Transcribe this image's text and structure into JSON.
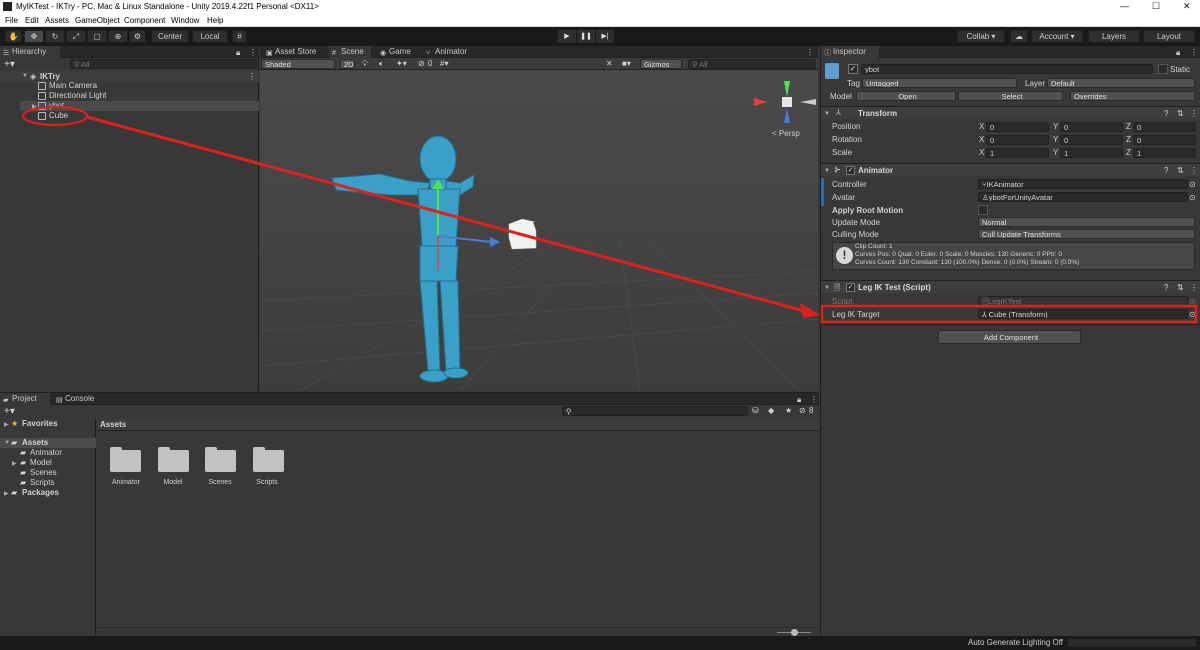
{
  "window": {
    "title": "MyIKTest - IKTry - PC, Mac & Linux Standalone - Unity 2019.4.22f1 Personal <DX11>",
    "min": "—",
    "max": "☐",
    "close": "✕"
  },
  "menu": [
    "File",
    "Edit",
    "Assets",
    "GameObject",
    "Component",
    "Window",
    "Help"
  ],
  "toolbar": {
    "pivot": "Center",
    "space": "Local",
    "collab": "Collab ▾",
    "account": "Account ▾",
    "layers": "Layers",
    "layout": "Layout"
  },
  "hierarchy": {
    "tab": "Hierarchy",
    "search_placeholder": "All",
    "scene": "IKTry",
    "items": [
      "Main Camera",
      "Directional Light",
      "ybot",
      "Cube"
    ]
  },
  "scene_tabs": [
    "Asset Store",
    "Scene",
    "Game",
    "Animator"
  ],
  "scene_toolbar": {
    "shading": "Shaded",
    "mode2d": "2D",
    "hidden_count": "0",
    "gizmos": "Gizmos",
    "search_placeholder": "All"
  },
  "scene_view": {
    "persp": "< Persp"
  },
  "inspector": {
    "tab": "Inspector",
    "object_name": "ybot",
    "static": "Static",
    "tag_label": "Tag",
    "tag_value": "Untagged",
    "layer_label": "Layer",
    "layer_value": "Default",
    "model_label": "Model",
    "open": "Open",
    "select": "Select",
    "overrides": "Overrides",
    "transform": {
      "title": "Transform",
      "rows": [
        {
          "label": "Position",
          "x": "0",
          "y": "0",
          "z": "0"
        },
        {
          "label": "Rotation",
          "x": "0",
          "y": "0",
          "z": "0"
        },
        {
          "label": "Scale",
          "x": "1",
          "y": "1",
          "z": "1"
        }
      ]
    },
    "animator": {
      "title": "Animator",
      "controller_label": "Controller",
      "controller_value": "IKAnimator",
      "avatar_label": "Avatar",
      "avatar_value": "ybotForUnityAvatar",
      "root_motion_label": "Apply Root Motion",
      "update_mode_label": "Update Mode",
      "update_mode_value": "Normal",
      "culling_label": "Culling Mode",
      "culling_value": "Cull Update Transforms",
      "info_line1": "Clip Count: 1",
      "info_line2": "Curves Pos: 0 Quat: 0 Euler: 0 Scale: 0 Muscles: 130 Generic: 0 PPtr: 0",
      "info_line3": "Curves Count: 130 Constant: 130 (100.0%) Dense: 0 (0.0%) Stream: 0 (0.0%)"
    },
    "script_comp": {
      "title": "Leg IK Test (Script)",
      "script_label": "Script",
      "script_value": "LegIKTest",
      "target_label": "Leg IK Target",
      "target_value": "Cube (Transform)"
    },
    "add_component": "Add Component"
  },
  "project": {
    "tabs": [
      "Project",
      "Console"
    ],
    "tree": [
      {
        "label": "Favorites",
        "level": 0
      },
      {
        "label": "Assets",
        "level": 0
      },
      {
        "label": "Animator",
        "level": 1
      },
      {
        "label": "Model",
        "level": 1
      },
      {
        "label": "Scenes",
        "level": 1
      },
      {
        "label": "Scripts",
        "level": 1
      },
      {
        "label": "Packages",
        "level": 0
      }
    ],
    "breadcrumb": "Assets",
    "folders": [
      "Animator",
      "Model",
      "Scenes",
      "Scripts"
    ],
    "hidden_count": "8"
  },
  "statusbar": {
    "text": "Auto Generate Lighting Off"
  },
  "colors": {
    "annotation_red": "#e0201c",
    "selection_blue": "#2c5d87",
    "bot_blue": "#3aa0c8"
  }
}
